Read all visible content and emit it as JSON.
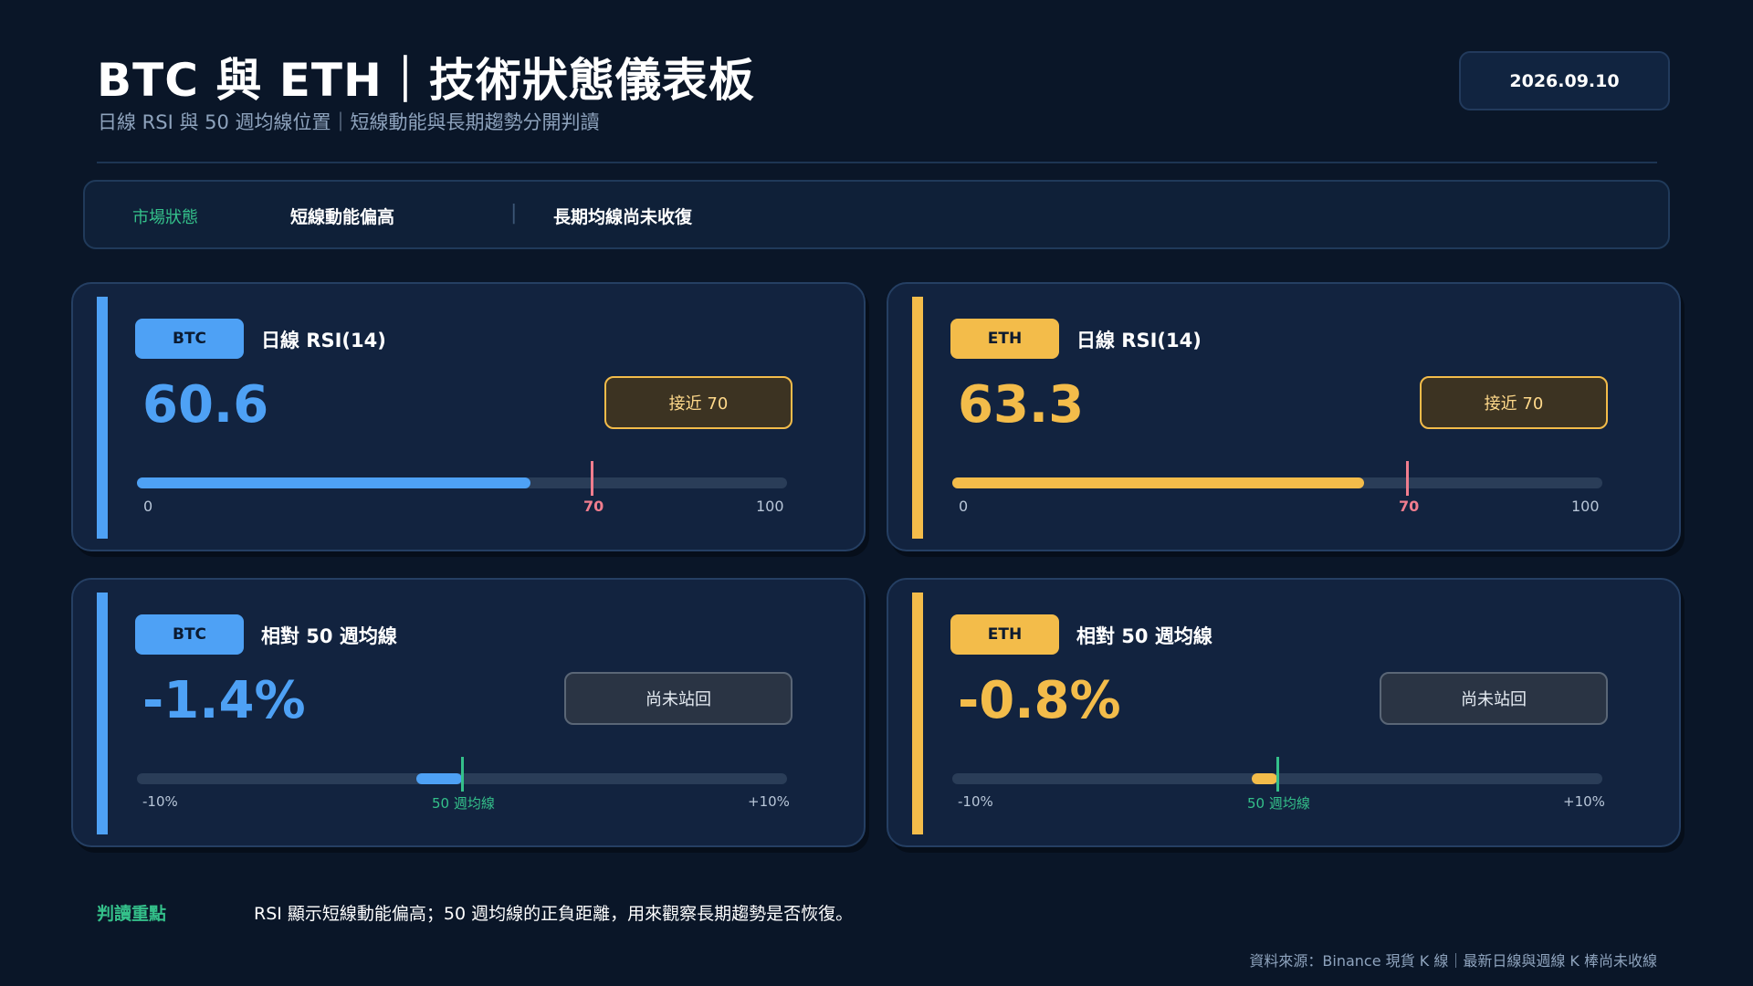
{
  "header": {
    "title": "BTC 與 ETH｜技術狀態儀表板",
    "subtitle": "日線 RSI 與 50 週均線位置｜短線動能與長期趨勢分開判讀",
    "date": "2026.09.10"
  },
  "status": {
    "label": "市場狀態",
    "short_term": "短線動能偏高",
    "separator": "|",
    "long_term": "長期均線尚未收復"
  },
  "colors": {
    "background": "#0a1628",
    "btc": "#4ea1f5",
    "eth": "#f3bc4a",
    "threshold_red": "#f07d8e",
    "ma_green": "#34c08a"
  },
  "cards": {
    "btc_rsi": {
      "tag": "BTC",
      "metric": "日線 RSI(14)",
      "value": "60.6",
      "value_num": 60.6,
      "badge": "接近 70",
      "scale_min": 0,
      "scale_max": 100,
      "threshold": 70,
      "tick_min": "0",
      "tick_mid": "70",
      "tick_max": "100"
    },
    "eth_rsi": {
      "tag": "ETH",
      "metric": "日線 RSI(14)",
      "value": "63.3",
      "value_num": 63.3,
      "badge": "接近 70",
      "scale_min": 0,
      "scale_max": 100,
      "threshold": 70,
      "tick_min": "0",
      "tick_mid": "70",
      "tick_max": "100"
    },
    "btc_ma": {
      "tag": "BTC",
      "metric": "相對 50 週均線",
      "value": "-1.4%",
      "value_num": -1.4,
      "badge": "尚未站回",
      "scale_min": -10,
      "scale_max": 10,
      "tick_min": "-10%",
      "tick_mid": "50 週均線",
      "tick_max": "+10%"
    },
    "eth_ma": {
      "tag": "ETH",
      "metric": "相對 50 週均線",
      "value": "-0.8%",
      "value_num": -0.8,
      "badge": "尚未站回",
      "scale_min": -10,
      "scale_max": 10,
      "tick_min": "-10%",
      "tick_mid": "50 週均線",
      "tick_max": "+10%"
    }
  },
  "note": {
    "label": "判讀重點",
    "text": "RSI 顯示短線動能偏高；50 週均線的正負距離，用來觀察長期趨勢是否恢復。"
  },
  "source": "資料來源：Binance 現貨 K 線｜最新日線與週線 K 棒尚未收線"
}
